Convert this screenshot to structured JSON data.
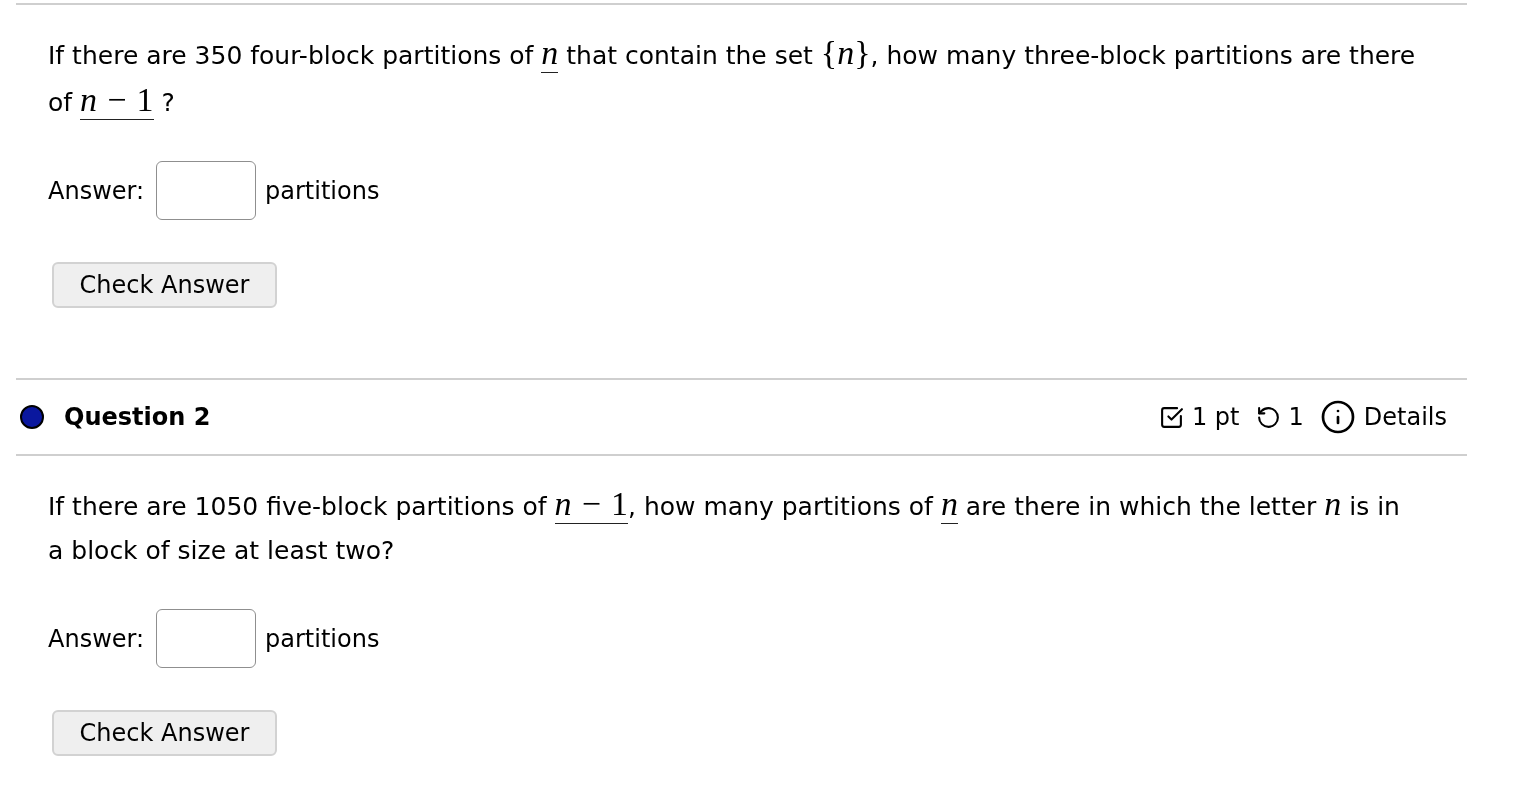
{
  "questions": [
    {
      "prompt": [
        {
          "kind": "text",
          "text": "If there are 350 four-block partitions of "
        },
        {
          "kind": "math",
          "underlined": true,
          "tokens": [
            {
              "kind": "var",
              "text": "n"
            }
          ]
        },
        {
          "kind": "text",
          "text": " that contain the set "
        },
        {
          "kind": "math",
          "underlined": false,
          "tokens": [
            {
              "kind": "brace",
              "text": "{"
            },
            {
              "kind": "var",
              "text": "n"
            },
            {
              "kind": "brace",
              "text": "}"
            }
          ]
        },
        {
          "kind": "text",
          "text": ", how many three-block partitions are there of "
        },
        {
          "kind": "math",
          "underlined": true,
          "tokens": [
            {
              "kind": "var",
              "text": "n"
            },
            {
              "kind": "op",
              "text": "−"
            },
            {
              "kind": "num",
              "text": "1"
            }
          ]
        },
        {
          "kind": "text",
          "text": " ?"
        }
      ],
      "answer": {
        "label": "Answer:",
        "unit": "partitions"
      },
      "button": "Check Answer"
    },
    {
      "header": {
        "title": "Question 2",
        "points": "1 pt",
        "attempts": "1",
        "details": "Details"
      },
      "prompt": [
        {
          "kind": "text",
          "text": "If there are 1050 five-block partitions of "
        },
        {
          "kind": "math",
          "underlined": true,
          "tokens": [
            {
              "kind": "var",
              "text": "n"
            },
            {
              "kind": "op",
              "text": "−"
            },
            {
              "kind": "num",
              "text": "1"
            }
          ]
        },
        {
          "kind": "text",
          "text": ", how many partitions of "
        },
        {
          "kind": "math",
          "underlined": true,
          "tokens": [
            {
              "kind": "var",
              "text": "n"
            }
          ]
        },
        {
          "kind": "text",
          "text": " are there in which the letter "
        },
        {
          "kind": "math",
          "underlined": false,
          "tokens": [
            {
              "kind": "var",
              "text": "n"
            }
          ]
        },
        {
          "kind": "text",
          "text": " is in a block of size at least two?"
        }
      ],
      "answer": {
        "label": "Answer:",
        "unit": "partitions"
      },
      "button": "Check Answer"
    }
  ]
}
